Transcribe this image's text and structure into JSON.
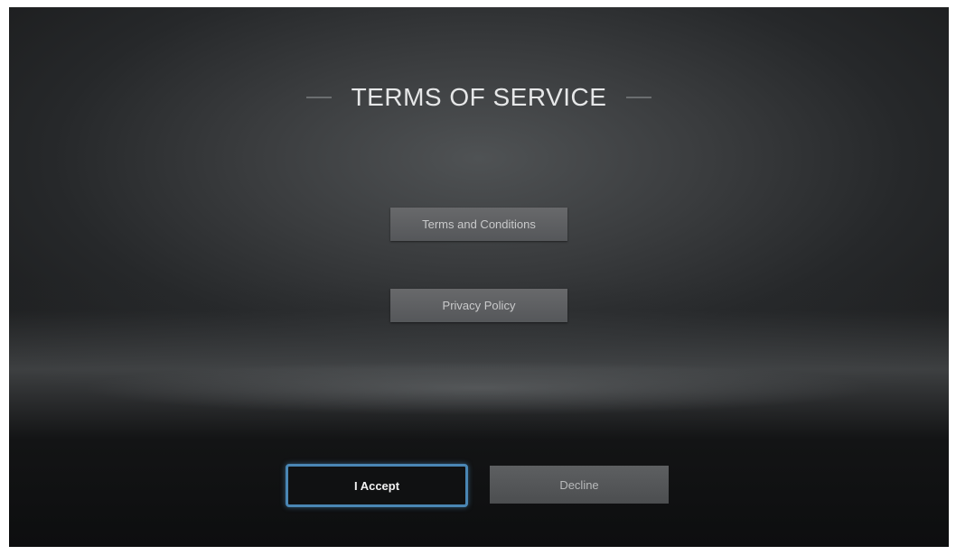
{
  "screen": {
    "title": "TERMS OF SERVICE"
  },
  "documents": {
    "terms_label": "Terms and Conditions",
    "privacy_label": "Privacy Policy"
  },
  "actions": {
    "accept_label": "I Accept",
    "decline_label": "Decline"
  },
  "colors": {
    "focus_border": "#4a86b4",
    "background": "#2a2c2e",
    "button_gray": "#5d5f61"
  }
}
